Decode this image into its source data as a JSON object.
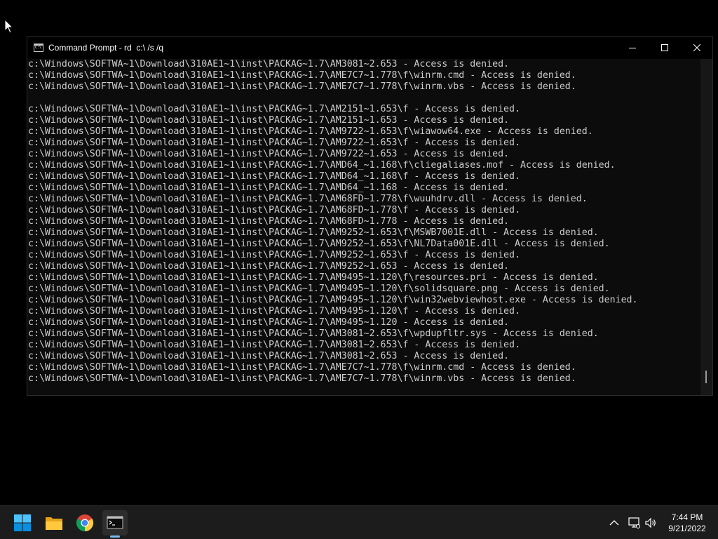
{
  "window": {
    "title": "Command Prompt - rd  c:\\ /s /q",
    "icon": "cmd-icon",
    "controls": [
      "minimize-icon",
      "maximize-icon",
      "close-icon"
    ]
  },
  "console": {
    "lines": [
      "c:\\Windows\\SOFTWA~1\\Download\\310AE1~1\\inst\\PACKAG~1.7\\AM3081~2.653 - Access is denied.",
      "c:\\Windows\\SOFTWA~1\\Download\\310AE1~1\\inst\\PACKAG~1.7\\AME7C7~1.778\\f\\winrm.cmd - Access is denied.",
      "c:\\Windows\\SOFTWA~1\\Download\\310AE1~1\\inst\\PACKAG~1.7\\AME7C7~1.778\\f\\winrm.vbs - Access is denied.",
      "",
      "c:\\Windows\\SOFTWA~1\\Download\\310AE1~1\\inst\\PACKAG~1.7\\AM2151~1.653\\f - Access is denied.",
      "c:\\Windows\\SOFTWA~1\\Download\\310AE1~1\\inst\\PACKAG~1.7\\AM2151~1.653 - Access is denied.",
      "c:\\Windows\\SOFTWA~1\\Download\\310AE1~1\\inst\\PACKAG~1.7\\AM9722~1.653\\f\\wiawow64.exe - Access is denied.",
      "c:\\Windows\\SOFTWA~1\\Download\\310AE1~1\\inst\\PACKAG~1.7\\AM9722~1.653\\f - Access is denied.",
      "c:\\Windows\\SOFTWA~1\\Download\\310AE1~1\\inst\\PACKAG~1.7\\AM9722~1.653 - Access is denied.",
      "c:\\Windows\\SOFTWA~1\\Download\\310AE1~1\\inst\\PACKAG~1.7\\AMD64_~1.168\\f\\cliegaliases.mof - Access is denied.",
      "c:\\Windows\\SOFTWA~1\\Download\\310AE1~1\\inst\\PACKAG~1.7\\AMD64_~1.168\\f - Access is denied.",
      "c:\\Windows\\SOFTWA~1\\Download\\310AE1~1\\inst\\PACKAG~1.7\\AMD64_~1.168 - Access is denied.",
      "c:\\Windows\\SOFTWA~1\\Download\\310AE1~1\\inst\\PACKAG~1.7\\AM68FD~1.778\\f\\wuuhdrv.dll - Access is denied.",
      "c:\\Windows\\SOFTWA~1\\Download\\310AE1~1\\inst\\PACKAG~1.7\\AM68FD~1.778\\f - Access is denied.",
      "c:\\Windows\\SOFTWA~1\\Download\\310AE1~1\\inst\\PACKAG~1.7\\AM68FD~1.778 - Access is denied.",
      "c:\\Windows\\SOFTWA~1\\Download\\310AE1~1\\inst\\PACKAG~1.7\\AM9252~1.653\\f\\MSWB7001E.dll - Access is denied.",
      "c:\\Windows\\SOFTWA~1\\Download\\310AE1~1\\inst\\PACKAG~1.7\\AM9252~1.653\\f\\NL7Data001E.dll - Access is denied.",
      "c:\\Windows\\SOFTWA~1\\Download\\310AE1~1\\inst\\PACKAG~1.7\\AM9252~1.653\\f - Access is denied.",
      "c:\\Windows\\SOFTWA~1\\Download\\310AE1~1\\inst\\PACKAG~1.7\\AM9252~1.653 - Access is denied.",
      "c:\\Windows\\SOFTWA~1\\Download\\310AE1~1\\inst\\PACKAG~1.7\\AM9495~1.120\\f\\resources.pri - Access is denied.",
      "c:\\Windows\\SOFTWA~1\\Download\\310AE1~1\\inst\\PACKAG~1.7\\AM9495~1.120\\f\\solidsquare.png - Access is denied.",
      "c:\\Windows\\SOFTWA~1\\Download\\310AE1~1\\inst\\PACKAG~1.7\\AM9495~1.120\\f\\win32webviewhost.exe - Access is denied.",
      "c:\\Windows\\SOFTWA~1\\Download\\310AE1~1\\inst\\PACKAG~1.7\\AM9495~1.120\\f - Access is denied.",
      "c:\\Windows\\SOFTWA~1\\Download\\310AE1~1\\inst\\PACKAG~1.7\\AM9495~1.120 - Access is denied.",
      "c:\\Windows\\SOFTWA~1\\Download\\310AE1~1\\inst\\PACKAG~1.7\\AM3081~2.653\\f\\wpdupfltr.sys - Access is denied.",
      "c:\\Windows\\SOFTWA~1\\Download\\310AE1~1\\inst\\PACKAG~1.7\\AM3081~2.653\\f - Access is denied.",
      "c:\\Windows\\SOFTWA~1\\Download\\310AE1~1\\inst\\PACKAG~1.7\\AM3081~2.653 - Access is denied.",
      "c:\\Windows\\SOFTWA~1\\Download\\310AE1~1\\inst\\PACKAG~1.7\\AME7C7~1.778\\f\\winrm.cmd - Access is denied.",
      "c:\\Windows\\SOFTWA~1\\Download\\310AE1~1\\inst\\PACKAG~1.7\\AME7C7~1.778\\f\\winrm.vbs - Access is denied."
    ]
  },
  "taskbar": {
    "items": [
      {
        "icon": "windows-start-icon"
      },
      {
        "icon": "file-explorer-icon"
      },
      {
        "icon": "chrome-icon"
      },
      {
        "icon": "command-prompt-icon",
        "active": true
      }
    ],
    "tray": [
      "chevron-up-icon",
      "network-icon",
      "volume-icon"
    ],
    "clock": {
      "time": "7:44 PM",
      "date": "9/21/2022"
    }
  },
  "colors": {
    "desktop": "#000000",
    "console_bg": "#0c0c0c",
    "console_text": "#cccccc",
    "taskbar_bg": "#1c1c1c",
    "accent": "#76b9ed"
  }
}
